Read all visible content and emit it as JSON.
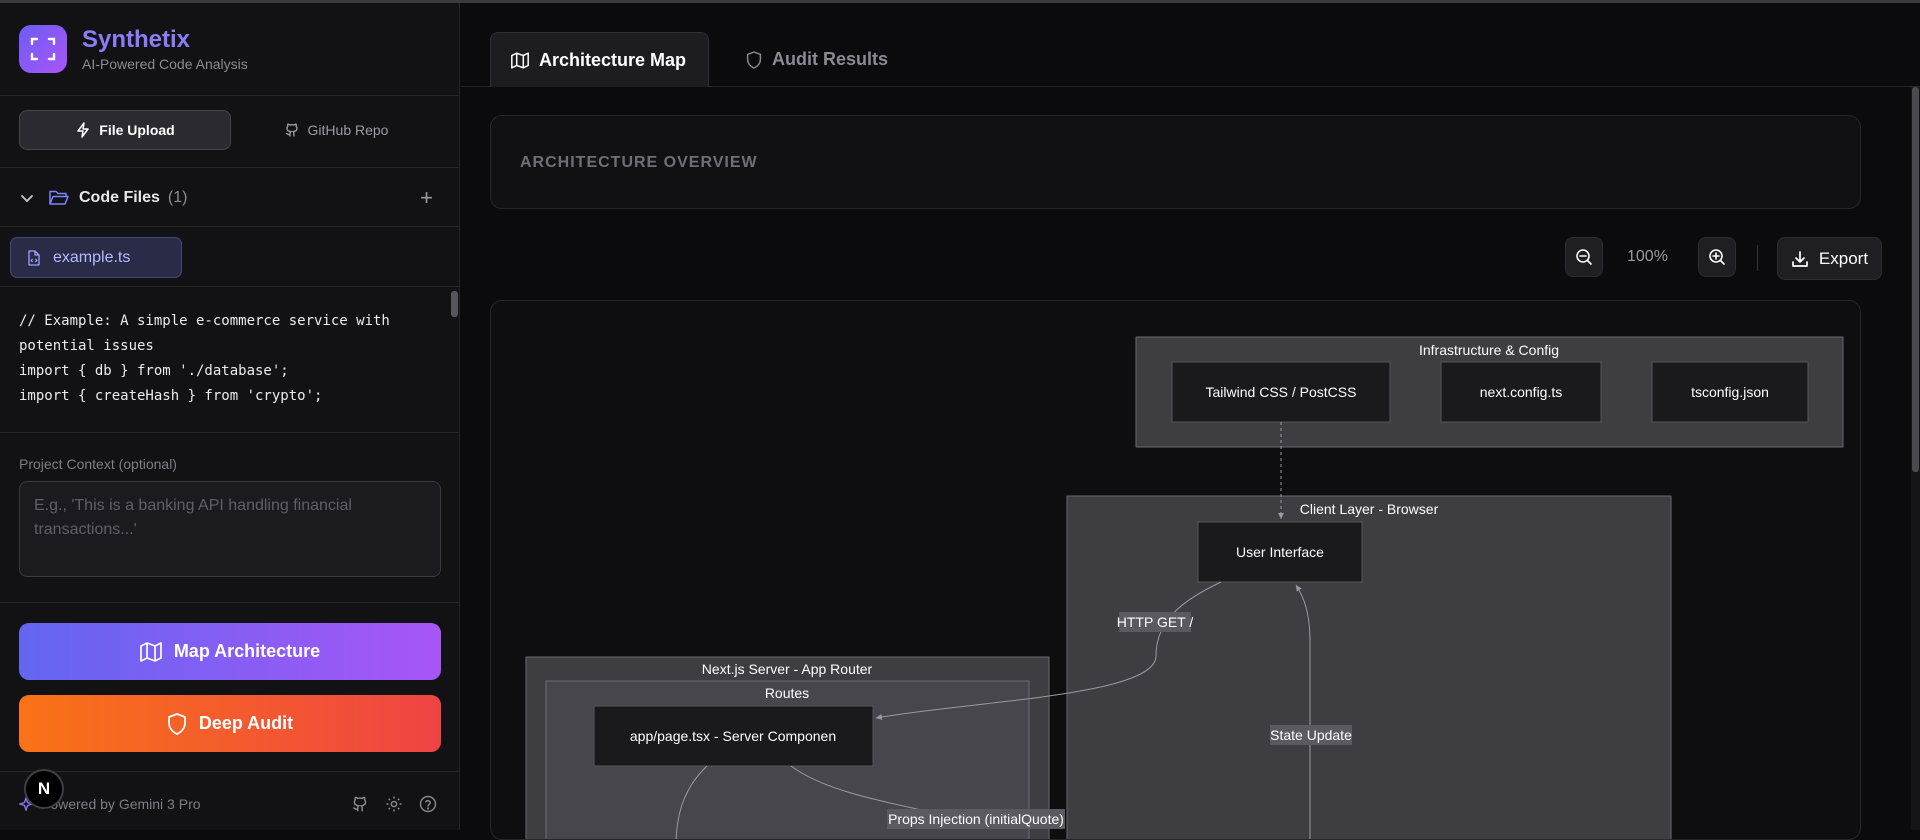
{
  "brand": {
    "name": "Synthetix",
    "tagline": "AI-Powered Code Analysis"
  },
  "source_modes": [
    {
      "label": "File Upload",
      "icon": "lightning-icon",
      "active": true
    },
    {
      "label": "GitHub Repo",
      "icon": "github-icon",
      "active": false
    }
  ],
  "files": {
    "title": "Code Files",
    "count": "(1)",
    "items": [
      {
        "name": "example.ts"
      }
    ]
  },
  "code_preview": "// Example: A simple e-commerce service with potential issues\nimport { db } from './database';\nimport { createHash } from 'crypto';",
  "context": {
    "label": "Project Context (optional)",
    "placeholder": "E.g., 'This is a banking API handling financial transactions...'"
  },
  "actions": {
    "map_label": "Map Architecture",
    "audit_label": "Deep Audit"
  },
  "footer": {
    "powered_by": "Powered by Gemini 3 Pro",
    "badge": "N"
  },
  "tabs": [
    {
      "label": "Architecture Map",
      "active": true
    },
    {
      "label": "Audit Results",
      "active": false
    }
  ],
  "overview": {
    "title": "ARCHITECTURE OVERVIEW"
  },
  "toolbar": {
    "zoom": "100%",
    "export_label": "Export"
  },
  "diagram": {
    "groups": {
      "infra": "Infrastructure & Config",
      "client": "Client Layer - Browser",
      "server": "Next.js Server - App Router",
      "routes": "Routes"
    },
    "nodes": {
      "tailwind": "Tailwind CSS / PostCSS",
      "nextconfig": "next.config.ts",
      "tsconfig": "tsconfig.json",
      "ui": "User Interface",
      "page": "app/page.tsx - Server Componen"
    },
    "edges": {
      "http": "HTTP GET /",
      "state": "State Update",
      "props": "Props Injection (initialQuote)"
    }
  },
  "colors": {
    "accent": "#8b7cf8",
    "map_gradient": [
      "#6366f1",
      "#a855f7"
    ],
    "audit_gradient": [
      "#f97316",
      "#ef4444"
    ]
  }
}
